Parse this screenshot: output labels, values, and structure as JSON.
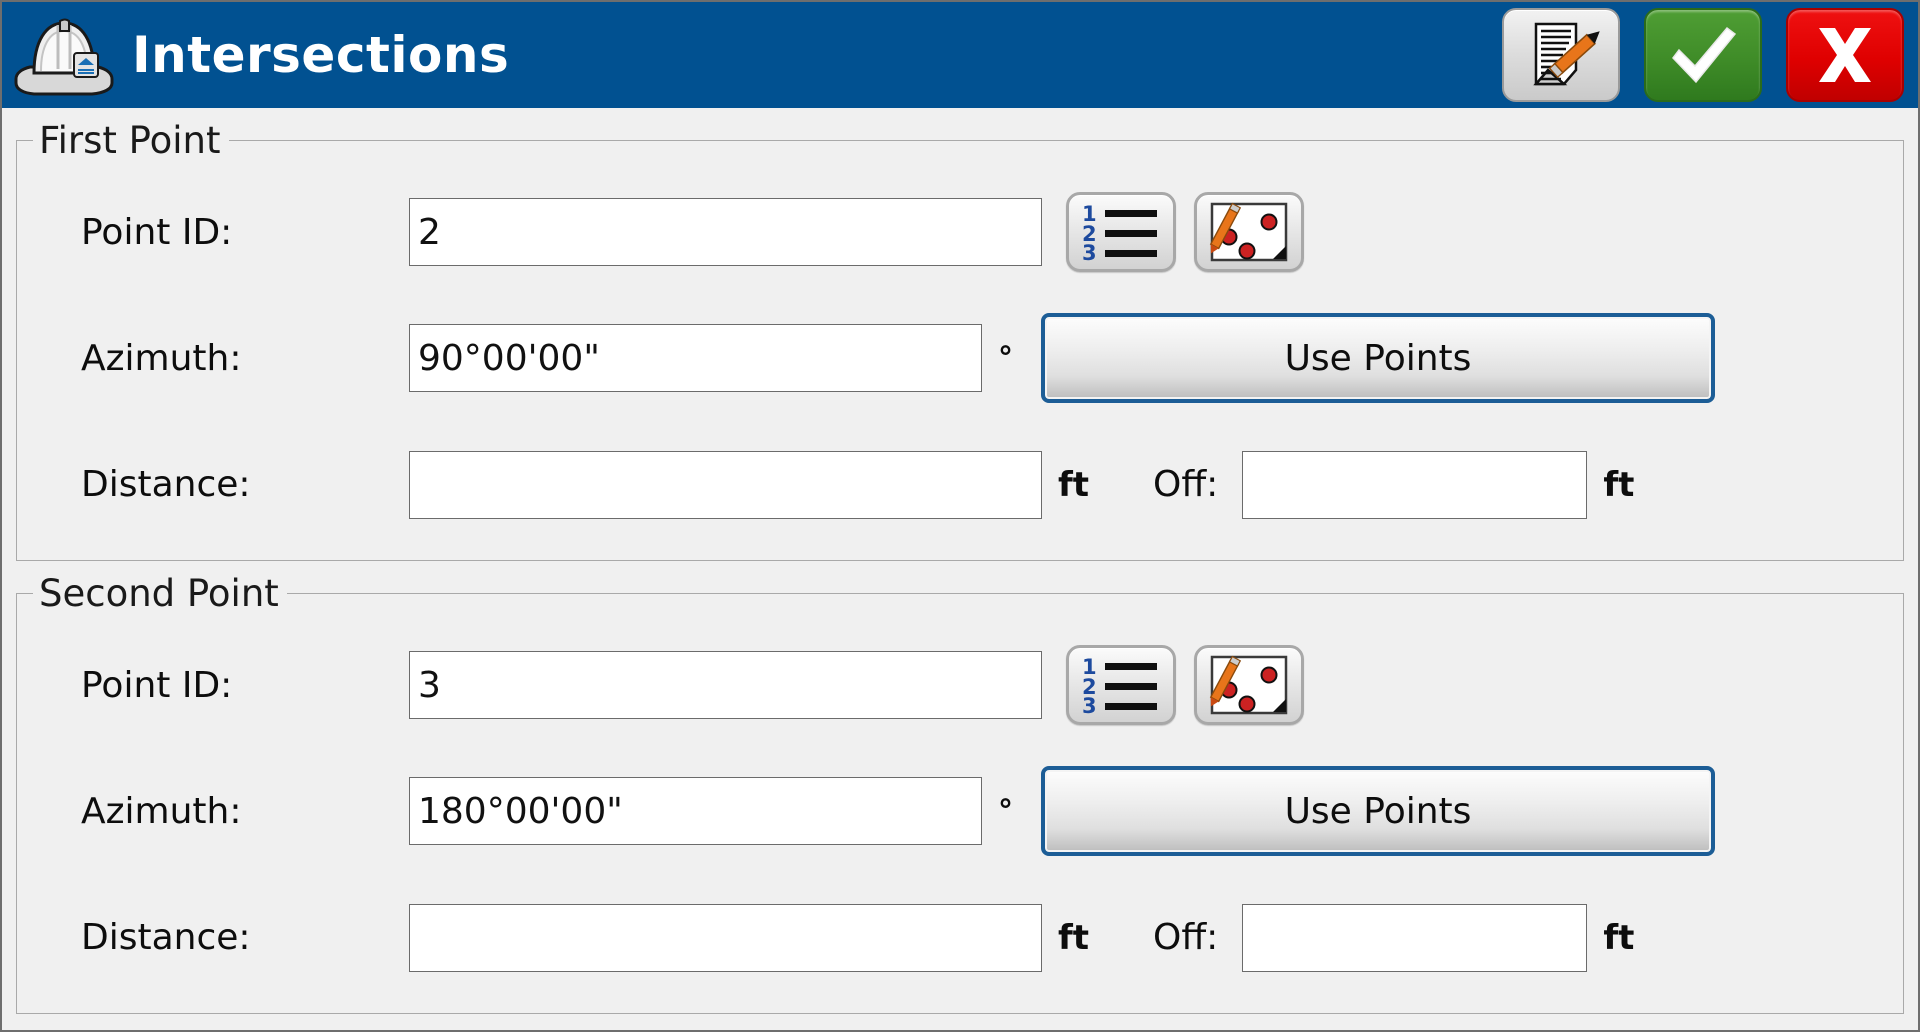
{
  "window": {
    "title": "Intersections",
    "app_icon": "hard-hat-icon",
    "titlebar_color": "#015191",
    "background_color": "#f0f0f0"
  },
  "titlebar_actions": [
    {
      "name": "notes-button",
      "icon": "document-pencil-icon",
      "color": "#dcdcdc"
    },
    {
      "name": "accept-button",
      "icon": "checkmark-icon",
      "color": "#3f8c28"
    },
    {
      "name": "cancel-button",
      "icon": "close-x-icon",
      "color": "#df0000"
    }
  ],
  "groups": [
    {
      "legend": "First Point",
      "point_id": {
        "label": "Point ID:",
        "value": "2",
        "placeholder": "",
        "list_button_icon": "numbered-list-icon",
        "map_button_icon": "pick-point-from-map-icon"
      },
      "azimuth": {
        "label": "Azimuth:",
        "value": "90°00'00\"",
        "placeholder": "",
        "unit": "°",
        "use_points_label": "Use Points"
      },
      "distance": {
        "label": "Distance:",
        "value": "",
        "placeholder": "",
        "unit": "ft"
      },
      "offset": {
        "label": "Off:",
        "value": "",
        "placeholder": "",
        "unit": "ft"
      }
    },
    {
      "legend": "Second Point",
      "point_id": {
        "label": "Point ID:",
        "value": "3",
        "placeholder": "",
        "list_button_icon": "numbered-list-icon",
        "map_button_icon": "pick-point-from-map-icon"
      },
      "azimuth": {
        "label": "Azimuth:",
        "value": "180°00'00\"",
        "placeholder": "",
        "unit": "°",
        "use_points_label": "Use Points"
      },
      "distance": {
        "label": "Distance:",
        "value": "",
        "placeholder": "",
        "unit": "ft"
      },
      "offset": {
        "label": "Off:",
        "value": "",
        "placeholder": "",
        "unit": "ft"
      }
    }
  ],
  "icon_list_digits": [
    "1",
    "2",
    "3"
  ]
}
